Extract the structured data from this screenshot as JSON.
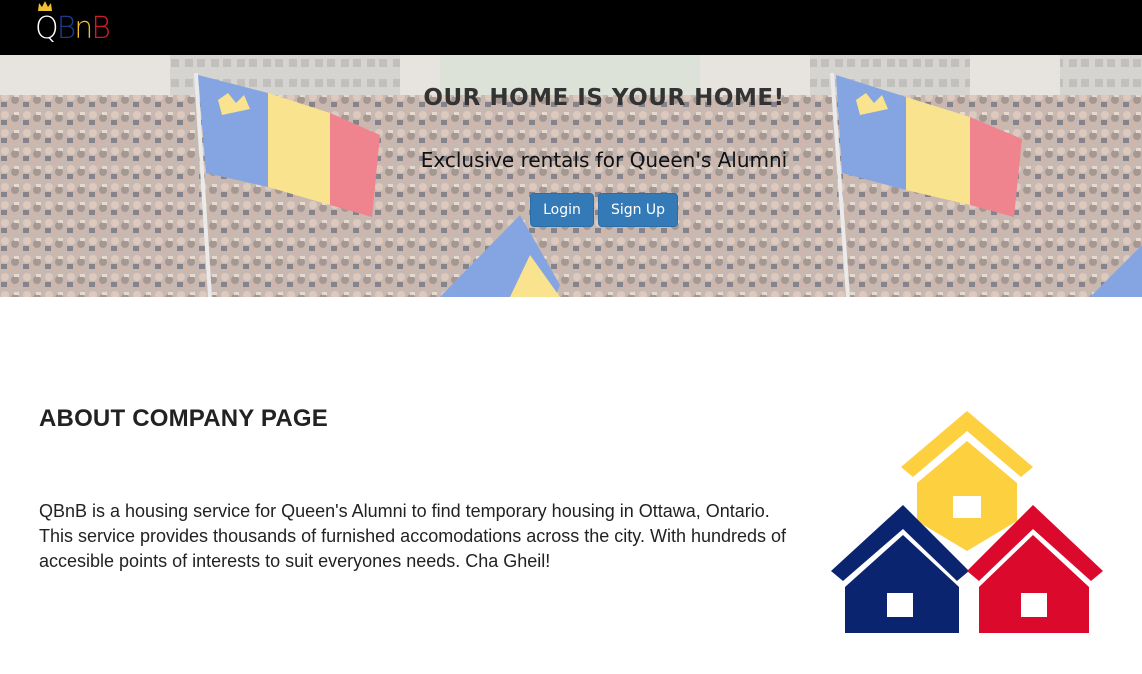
{
  "navbar": {
    "logo": {
      "q": "Q",
      "b1": "B",
      "n": "n",
      "b2": "B",
      "colors": {
        "q": "#ffffff",
        "b1": "#1b3b8c",
        "n": "#f0c030",
        "b2": "#d01a2a",
        "crown": "#f0c030"
      }
    }
  },
  "hero": {
    "title": "OUR HOME IS YOUR HOME!",
    "subtitle": "Exclusive rentals for Queen's Alumni",
    "login_label": "Login",
    "signup_label": "Sign Up",
    "button_color": "#337ab7"
  },
  "about": {
    "title": "ABOUT COMPANY PAGE",
    "text": "QBnB is a housing service for Queen's Alumni to find temporary housing in Ottawa, Ontario. This service provides thousands of furnished accomodations across the city. With hundreds of accesible points of interests to suit everyones needs. Cha Gheil!"
  },
  "illustration": {
    "icon": "houses-logo-icon",
    "colors": {
      "yellow": "#fcd03f",
      "navy": "#0b2470",
      "red": "#db0a2d"
    }
  }
}
